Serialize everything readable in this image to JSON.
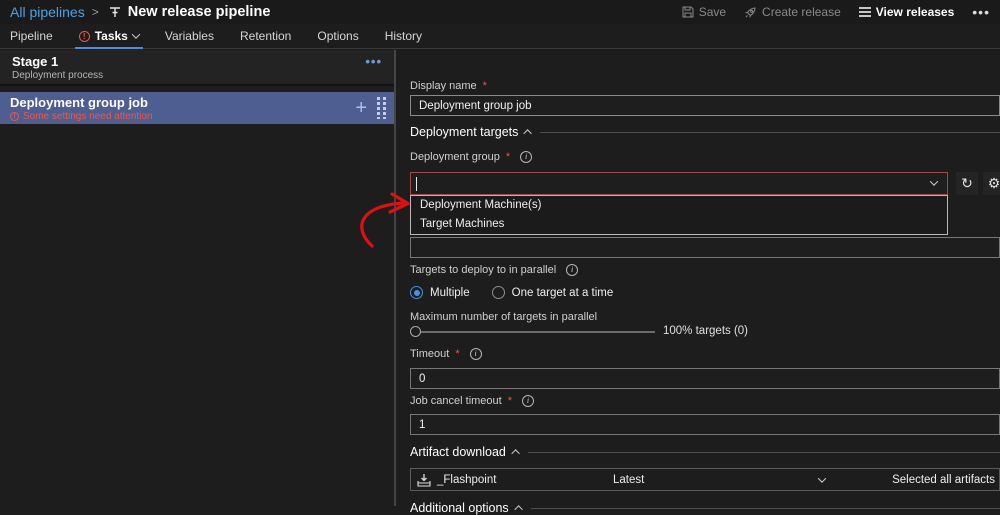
{
  "ui": {
    "required": "*",
    "info": "i",
    "warning": "!",
    "more": "•••",
    "plus": "+",
    "refresh": "↻",
    "gear": "⚙",
    "caret": ""
  },
  "header": {
    "breadcrumb_parent": "All pipelines",
    "breadcrumb_sep": ">",
    "title": "New release pipeline",
    "actions": {
      "save": "Save",
      "create_release": "Create release",
      "view_releases": "View releases"
    }
  },
  "tabs": [
    {
      "label": "Pipeline"
    },
    {
      "label": "Tasks"
    },
    {
      "label": "Variables"
    },
    {
      "label": "Retention"
    },
    {
      "label": "Options"
    },
    {
      "label": "History"
    }
  ],
  "left_panel": {
    "stage": {
      "title": "Stage 1",
      "subtitle": "Deployment process"
    },
    "job": {
      "title": "Deployment group job",
      "warning": "Some settings need attention"
    }
  },
  "form": {
    "display_name": {
      "label": "Display name",
      "value": "Deployment group job"
    },
    "section_deployment_targets": "Deployment targets",
    "deployment_group": {
      "label": "Deployment group",
      "value": "",
      "options": [
        "Deployment Machine(s)",
        "Target Machines"
      ]
    },
    "tags": {
      "value": ""
    },
    "targets_parallel": {
      "label": "Targets to deploy to in parallel",
      "option_multiple": "Multiple",
      "option_one": "One target at a time"
    },
    "max_targets": {
      "label": "Maximum number of targets in parallel",
      "value_text": "100% targets (0)"
    },
    "timeout": {
      "label": "Timeout",
      "value": "0"
    },
    "job_cancel_timeout": {
      "label": "Job cancel timeout",
      "value": "1"
    },
    "section_artifact_download": "Artifact download",
    "artifact": {
      "name": "_Flashpoint",
      "version": "Latest",
      "selection": "Selected all artifacts"
    },
    "section_additional_options": "Additional options"
  },
  "colors": {
    "accent_blue": "#4c8fd6",
    "link_blue": "#4ea1e6",
    "error_red": "#e5584a",
    "combo_error_border": "#a04a4a",
    "selected_job_bg": "#4f5e91",
    "annotation_red": "#dd1111"
  }
}
